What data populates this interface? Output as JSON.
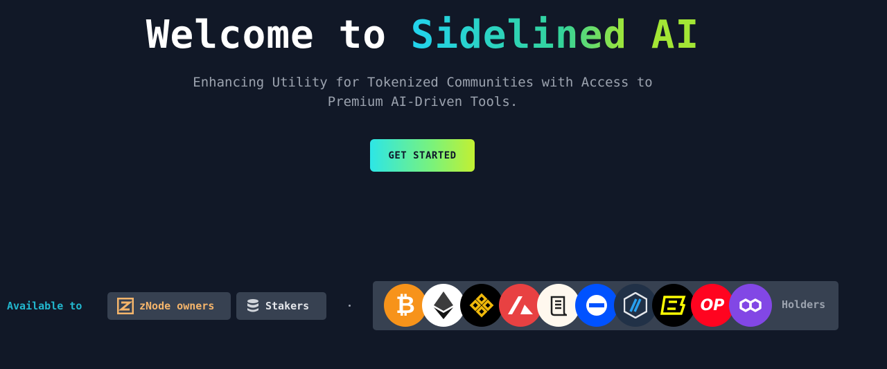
{
  "hero": {
    "title_prefix": "Welcome to ",
    "title_accent": "Sidelined",
    "title_suffix": "AI",
    "subtitle": "Enhancing Utility for Tokenized Communities with Access to Premium AI-Driven Tools.",
    "cta_label": "GET STARTED"
  },
  "availability": {
    "label": "Available to",
    "chips": [
      {
        "label": "zNode owners",
        "icon": "znode-icon"
      },
      {
        "label": "Stakers",
        "icon": "database-icon"
      }
    ],
    "holders_label": "Holders",
    "tokens": [
      {
        "name": "bitcoin",
        "glyph": "₿",
        "color": "#f7931a"
      },
      {
        "name": "ethereum",
        "color": "#ffffff"
      },
      {
        "name": "bnb",
        "color": "#000000"
      },
      {
        "name": "avalanche",
        "color": "#e84142"
      },
      {
        "name": "scroll",
        "color": "#fff8ee"
      },
      {
        "name": "base",
        "color": "#0052ff"
      },
      {
        "name": "arbitrum",
        "color": "#213147"
      },
      {
        "name": "blast",
        "color": "#000000"
      },
      {
        "name": "optimism",
        "glyph": "OP",
        "color": "#ff0420"
      },
      {
        "name": "polygon",
        "color": "#8247e5"
      }
    ]
  }
}
